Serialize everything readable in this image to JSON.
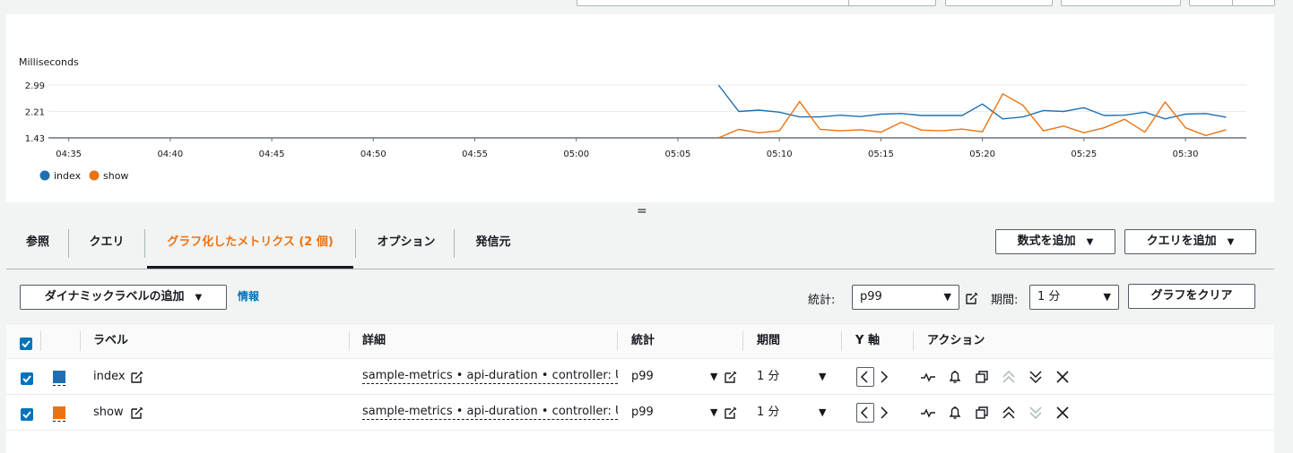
{
  "chart_data": {
    "type": "line",
    "ylabel": "Milliseconds",
    "yticks": [
      "2.99",
      "2.21",
      "1.43"
    ],
    "ylim": [
      1.43,
      2.99
    ],
    "xticks": [
      "04:35",
      "04:40",
      "04:45",
      "04:50",
      "04:55",
      "05:00",
      "05:05",
      "05:10",
      "05:15",
      "05:20",
      "05:25",
      "05:30"
    ],
    "xlim": [
      "04:34",
      "05:33"
    ],
    "grid": true,
    "legend_position": "bottom-left",
    "x": [
      "05:07",
      "05:08",
      "05:09",
      "05:10",
      "05:11",
      "05:12",
      "05:13",
      "05:14",
      "05:15",
      "05:16",
      "05:17",
      "05:18",
      "05:19",
      "05:20",
      "05:21",
      "05:22",
      "05:23",
      "05:24",
      "05:25",
      "05:26",
      "05:27",
      "05:28",
      "05:29",
      "05:30",
      "05:31",
      "05:32"
    ],
    "series": [
      {
        "name": "index",
        "color": "#1f6fb0",
        "values": [
          2.99,
          2.21,
          2.25,
          2.19,
          2.05,
          2.05,
          2.1,
          2.06,
          2.13,
          2.15,
          2.09,
          2.09,
          2.09,
          2.43,
          1.99,
          2.05,
          2.24,
          2.21,
          2.32,
          2.09,
          2.1,
          2.19,
          1.99,
          2.13,
          2.15,
          2.04
        ]
      },
      {
        "name": "show",
        "color": "#ec7211",
        "values": [
          1.43,
          1.68,
          1.58,
          1.64,
          2.5,
          1.68,
          1.64,
          1.67,
          1.6,
          1.89,
          1.66,
          1.64,
          1.69,
          1.61,
          2.73,
          2.39,
          1.64,
          1.78,
          1.58,
          1.73,
          1.98,
          1.6,
          2.49,
          1.73,
          1.5,
          1.67
        ]
      }
    ]
  },
  "splitter": "=",
  "tabs": [
    {
      "label": "参照"
    },
    {
      "label": "クエリ"
    },
    {
      "label": "グラフ化したメトリクス (2 個)"
    },
    {
      "label": "オプション"
    },
    {
      "label": "発信元"
    }
  ],
  "header_buttons": {
    "add_math": "数式を追加",
    "add_query": "クエリを追加"
  },
  "toolbar": {
    "dynamic_label": "ダイナミックラベルの追加",
    "info": "情報",
    "stat_label": "統計:",
    "stat_value": "p99",
    "period_label": "期間:",
    "period_value": "1 分",
    "clear_graph": "グラフをクリア"
  },
  "table": {
    "headers": {
      "label": "ラベル",
      "details": "詳細",
      "statistic": "統計",
      "period": "期間",
      "y_axis": "Y 軸",
      "actions": "アクション"
    },
    "rows": [
      {
        "label": "index",
        "color": "#1f6fb0",
        "details": "sample-metrics • api-duration • controller: Users",
        "statistic": "p99",
        "period": "1 分"
      },
      {
        "label": "show",
        "color": "#ec7211",
        "details": "sample-metrics • api-duration • controller: Users",
        "statistic": "p99",
        "period": "1 分"
      }
    ]
  }
}
